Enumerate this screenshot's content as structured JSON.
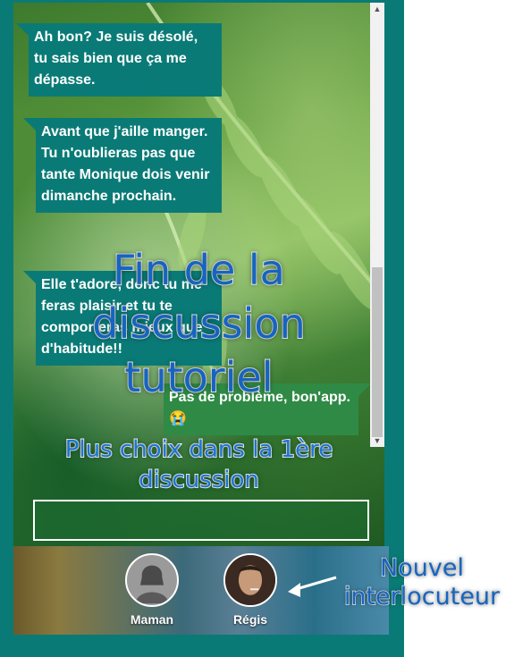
{
  "messages": [
    {
      "side": "left",
      "text": "Ah bon? Je suis désolé, tu sais bien que ça me dépasse."
    },
    {
      "side": "left",
      "text": "Avant que j'aille manger. Tu n'oublieras pas que tante Monique dois venir dimanche prochain."
    },
    {
      "side": "left",
      "text": "Elle t'adore, donc tu me feras plaisir et tu te comporteras mieux que d'habitude!!"
    },
    {
      "side": "right",
      "text": "Pas de problème, bon'app. 😭"
    }
  ],
  "overlay": {
    "title": "Fin de la discussion tutoriel",
    "subtitle": "Plus choix dans la 1ère discussion"
  },
  "contacts": [
    {
      "name": "Maman",
      "avatar": "silhouette-avatar"
    },
    {
      "name": "Régis",
      "avatar": "photo-avatar"
    }
  ],
  "annotation": {
    "text": "Nouvel interlocuteur",
    "icon": "arrow-left-icon"
  },
  "colors": {
    "frame": "#0a7a76",
    "bubble_left": "#0a7a76",
    "bubble_right": "#2f8a45",
    "overlay_text": "#1565c0"
  }
}
